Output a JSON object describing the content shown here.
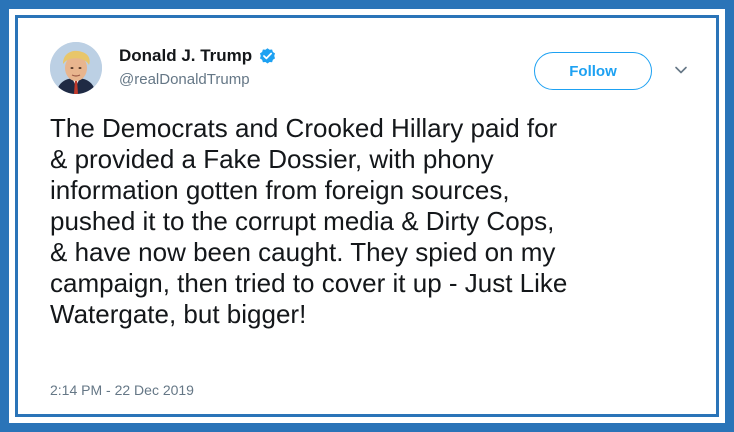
{
  "tweet": {
    "author": {
      "display_name": "Donald J. Trump",
      "handle": "@realDonaldTrump",
      "verified_icon": "verified-badge-icon",
      "avatar": "profile-avatar"
    },
    "follow_button": {
      "label": "Follow"
    },
    "menu_icon": "chevron-down-icon",
    "text_lines": [
      "The Democrats and Crooked Hillary paid for",
      "& provided a Fake Dossier, with phony",
      "information gotten from foreign sources,",
      "pushed it to the corrupt media & Dirty Cops,",
      "& have now been caught. They spied on my",
      "campaign, then tried to cover it up - Just Like",
      "Watergate, but bigger!"
    ],
    "timestamp": "2:14 PM - 22 Dec 2019"
  },
  "colors": {
    "frame": "#2a74b8",
    "accent": "#1da1f2",
    "text": "#14171a",
    "muted": "#657786"
  }
}
